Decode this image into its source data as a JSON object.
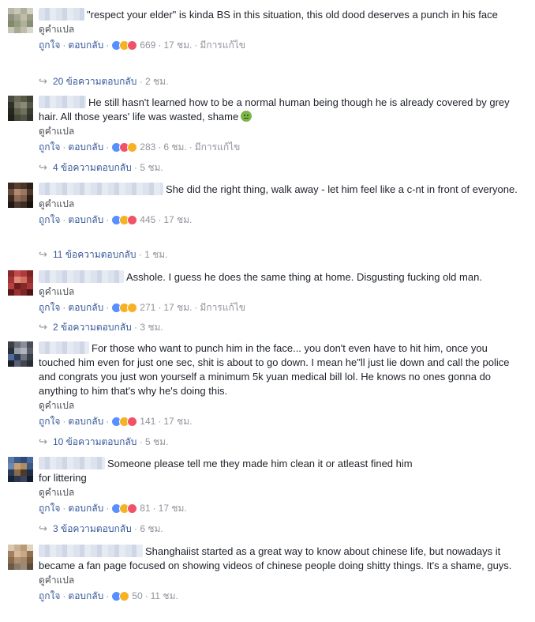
{
  "comments": [
    {
      "text": "\"respect your elder\" is kinda BS in this situation, this old dood deserves a punch in his face",
      "translate": "ดูคำแปล",
      "like": "ถูกใจ",
      "reply": "ตอบกลับ",
      "reactions": [
        "like",
        "haha",
        "love"
      ],
      "count": "669",
      "time": "17 ชม.",
      "edited": "มีการแก้ไข",
      "replies_label": "20 ข้อความตอบกลับ",
      "replies_time": "2 ชม."
    },
    {
      "text": "He still hasn't learned how to be a normal human being though he is already covered by grey hair. All those years' life was wasted, shame",
      "emoji": "sick-face",
      "translate": "ดูคำแปล",
      "like": "ถูกใจ",
      "reply": "ตอบกลับ",
      "reactions": [
        "like",
        "love",
        "sad"
      ],
      "count": "283",
      "time": "6 ชม.",
      "edited": "มีการแก้ไข",
      "replies_label": "4 ข้อความตอบกลับ",
      "replies_time": "5 ชม."
    },
    {
      "text": "She did the right thing, walk away - let him feel like a c-nt in front of everyone.",
      "translate": "ดูคำแปล",
      "like": "ถูกใจ",
      "reply": "ตอบกลับ",
      "reactions": [
        "like",
        "haha",
        "love"
      ],
      "count": "445",
      "time": "17 ชม.",
      "replies_label": "11 ข้อความตอบกลับ",
      "replies_time": "1 ชม."
    },
    {
      "text": "Asshole. I guess he does the same thing at home. Disgusting fucking old man.",
      "translate": "ดูคำแปล",
      "like": "ถูกใจ",
      "reply": "ตอบกลับ",
      "reactions": [
        "like",
        "haha",
        "wow"
      ],
      "count": "271",
      "time": "17 ชม.",
      "edited": "มีการแก้ไข",
      "replies_label": "2 ข้อความตอบกลับ",
      "replies_time": "3 ชม."
    },
    {
      "text": "For those who want to punch him in the face... you don't even have to hit him, once you touched him even for just one sec, shit is about to go down. I mean he\"ll just lie down and call the police and congrats you just won yourself a minimum 5k yuan medical bill lol. He knows no ones gonna do anything to him that's why he's doing this.",
      "translate": "ดูคำแปล",
      "like": "ถูกใจ",
      "reply": "ตอบกลับ",
      "reactions": [
        "like",
        "haha",
        "love"
      ],
      "count": "141",
      "time": "17 ชม.",
      "replies_label": "10 ข้อความตอบกลับ",
      "replies_time": "5 ชม."
    },
    {
      "text": "Someone please tell me they made him clean it or atleast fined him",
      "text2": "for littering",
      "translate": "ดูคำแปล",
      "like": "ถูกใจ",
      "reply": "ตอบกลับ",
      "reactions": [
        "like",
        "haha",
        "love"
      ],
      "count": "81",
      "time": "17 ชม.",
      "replies_label": "3 ข้อความตอบกลับ",
      "replies_time": "6 ชม."
    },
    {
      "text": "Shanghaiist started as a great way to know about chinese life, but nowadays it became a fan page focused on showing videos of chinese people doing shitty things. It's a shame, guys.",
      "translate": "ดูคำแปล",
      "like": "ถูกใจ",
      "reply": "ตอบกลับ",
      "reactions": [
        "like",
        "haha"
      ],
      "count": "50",
      "time": "11 ชม."
    }
  ],
  "colors": {
    "link": "#365899",
    "meta": "#90949c",
    "text": "#1d2129",
    "like": "#5890ff",
    "haha": "#f7b125",
    "love": "#f25268"
  }
}
